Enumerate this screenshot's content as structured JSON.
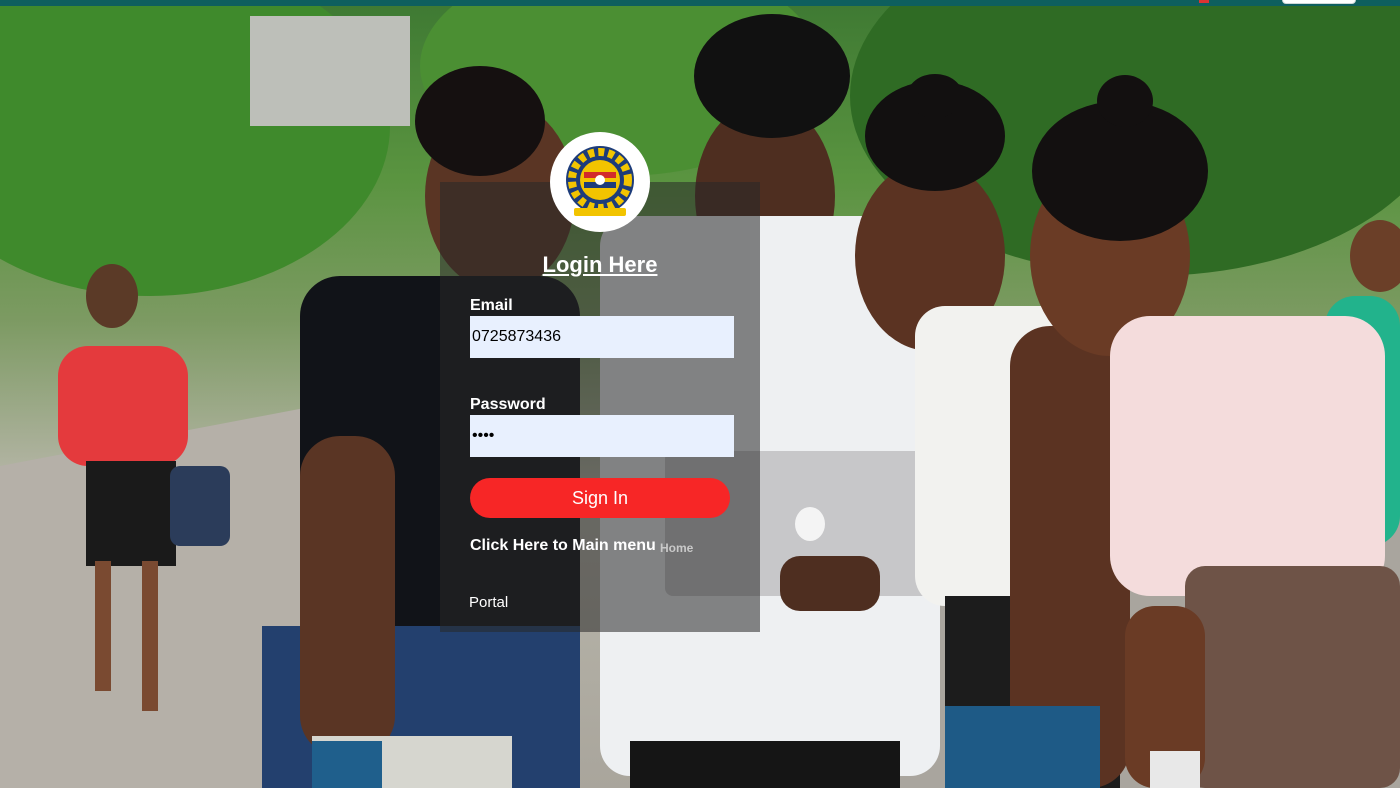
{
  "login": {
    "title": "Login Here",
    "email_label": "Email",
    "email_value": "0725873436",
    "password_label": "Password",
    "password_value": "••••",
    "signin_label": "Sign In",
    "menu_link": "Click Here to Main menu",
    "home_link": "Home",
    "portal_text": "Portal"
  },
  "colors": {
    "topbar": "#0e5f5e",
    "signin_button": "#f72626",
    "input_background": "#e8f0fe"
  },
  "icons": {
    "logo": "institution-logo-gear-emblem"
  }
}
